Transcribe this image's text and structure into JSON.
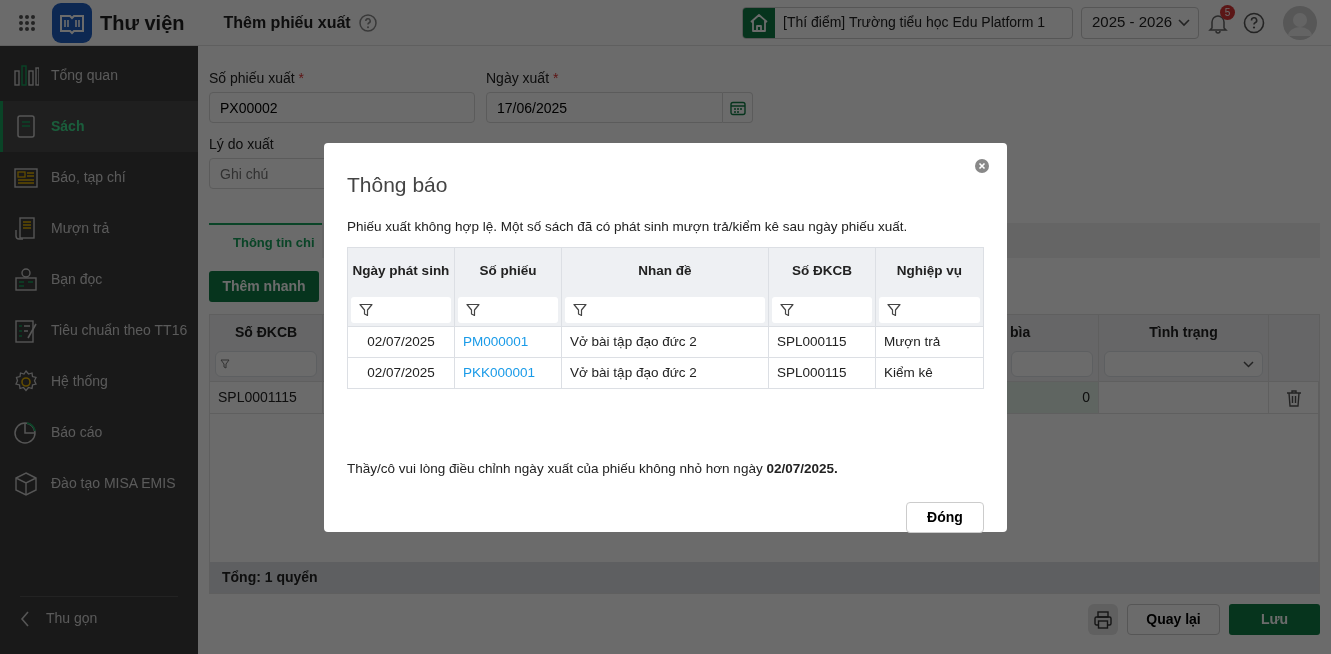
{
  "app": {
    "title": "Thư viện"
  },
  "page_title": "Thêm phiếu xuất",
  "school": "[Thí điểm] Trường tiểu học Edu Platform 1",
  "school_year": "2025 - 2026",
  "notifications": {
    "count": "5"
  },
  "sidebar": {
    "items": [
      {
        "label": "Tổng quan",
        "selected": false
      },
      {
        "label": "Sách",
        "selected": true
      },
      {
        "label": "Báo, tạp chí",
        "selected": false
      },
      {
        "label": "Mượn trả",
        "selected": false
      },
      {
        "label": "Bạn đọc",
        "selected": false
      },
      {
        "label": "Tiêu chuẩn theo TT16",
        "selected": false
      },
      {
        "label": "Hệ thống",
        "selected": false
      },
      {
        "label": "Báo cáo",
        "selected": false
      },
      {
        "label": "Đào tạo MISA EMIS",
        "selected": false
      }
    ],
    "collapse": "Thu gọn"
  },
  "form": {
    "fields": [
      {
        "kind": "text",
        "label": "Số phiếu xuất",
        "required_mark": "*",
        "value": "PX00002"
      },
      {
        "kind": "date",
        "label": "Ngày xuất",
        "required_mark": "*",
        "value": "17/06/2025"
      },
      {
        "kind": "text",
        "label": "Lý do xuất",
        "placeholder": "Ghi chú"
      }
    ]
  },
  "tabs": [
    {
      "label": "Thông tin chi",
      "selected": true
    }
  ],
  "quick_add_button": "Thêm nhanh",
  "items_table": {
    "columns": [
      "Số ĐKCB",
      "bìa",
      "Tình trạng"
    ],
    "rows": [
      {
        "cells": [
          "SPL0001115",
          "0"
        ]
      }
    ],
    "total": "Tổng: 1 quyển"
  },
  "actions": [
    "Quay lại",
    "Lưu"
  ],
  "dialog": {
    "title": "Thông báo",
    "message": "Phiếu xuất không hợp lệ. Một số sách đã có phát sinh mượn trả/kiểm kê sau ngày phiếu xuất.",
    "table": {
      "columns": [
        "Ngày phát sinh",
        "Số phiếu",
        "Nhan đề",
        "Số ĐKCB",
        "Nghiệp vụ"
      ],
      "rows": [
        {
          "cells": [
            "02/07/2025",
            "PM000001",
            "Vở bài tập đạo đức 2",
            "SPL000115",
            "Mượn trả"
          ]
        },
        {
          "cells": [
            "02/07/2025",
            "PKK000001",
            "Vở bài tập đạo đức 2",
            "SPL000115",
            "Kiểm kê"
          ]
        }
      ]
    },
    "note": "Thầy/cô vui lòng điều chỉnh ngày xuất của phiếu không nhỏ hơn ngày **02/07/2025.**",
    "button": "Đóng"
  }
}
